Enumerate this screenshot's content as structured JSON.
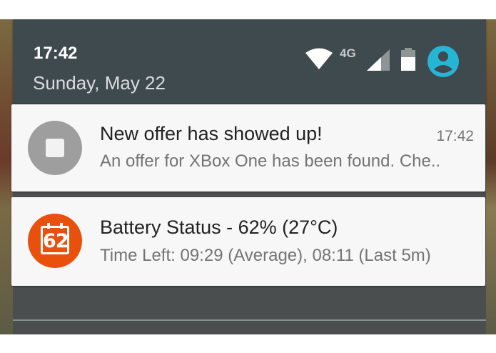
{
  "status_bar": {
    "time": "17:42",
    "date": "Sunday, May 22",
    "network_type": "4G",
    "icons": [
      "wifi-icon",
      "signal-icon",
      "battery-icon",
      "user-account-icon"
    ],
    "accent_color": "#26b5d4"
  },
  "notifications": [
    {
      "icon": "stop-icon",
      "title": "New offer has showed up!",
      "time": "17:42",
      "text": "An offer for XBox One has been found. Che.."
    },
    {
      "icon": "battery-calendar-icon",
      "icon_label": "62",
      "title": "Battery Status - 62% (27°C)",
      "text": "Time Left: 09:29 (Average), 08:11 (Last 5m)",
      "icon_color": "#e8500c"
    }
  ]
}
